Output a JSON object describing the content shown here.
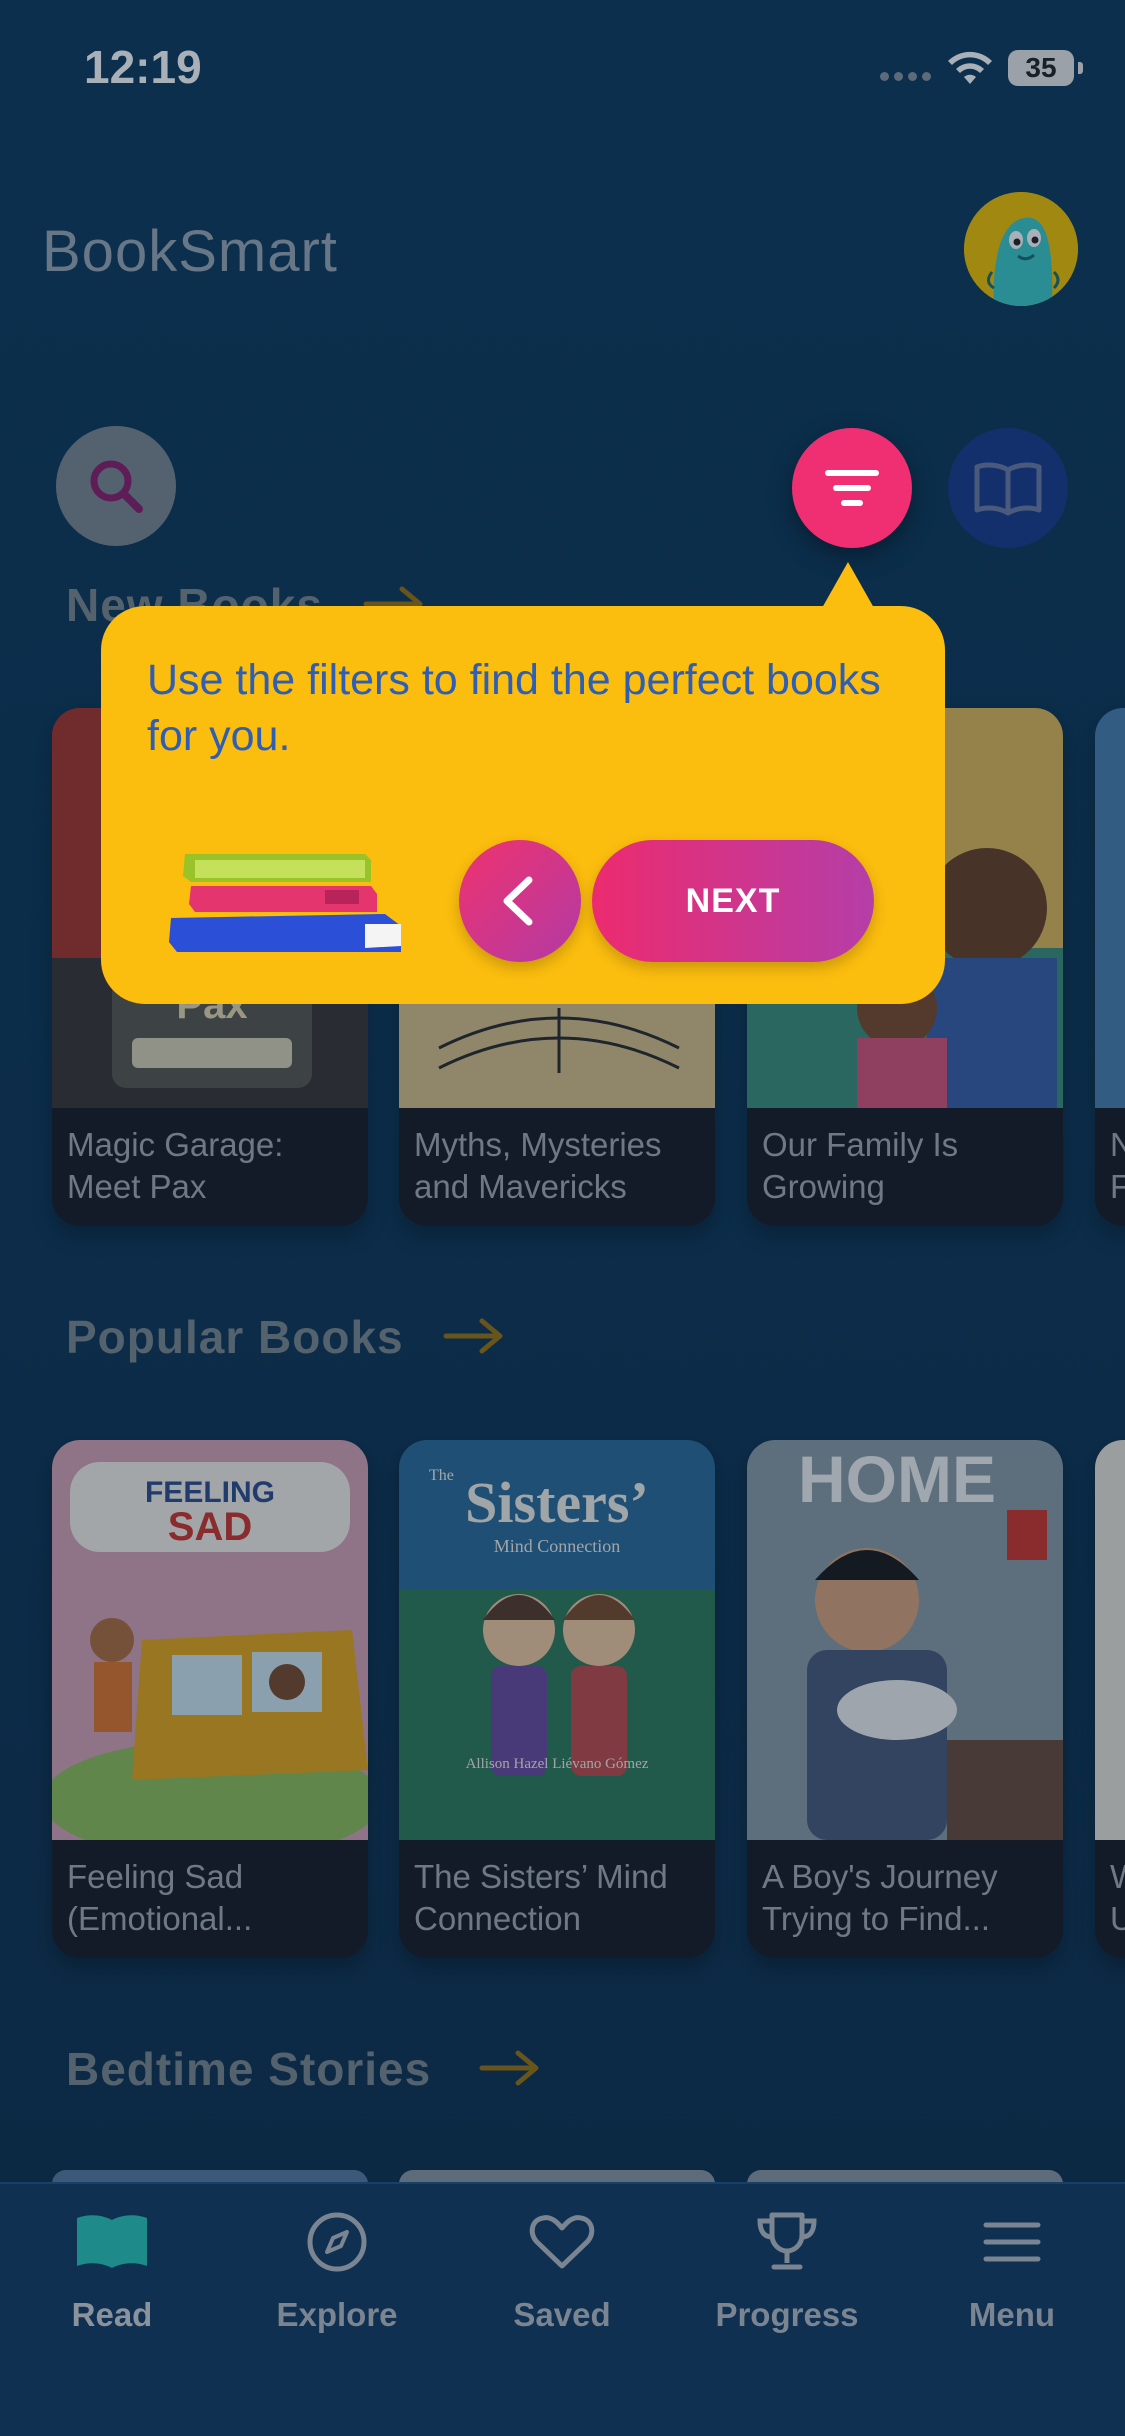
{
  "status_bar": {
    "time": "12:19",
    "battery": "35"
  },
  "header": {
    "app_title": "BookSmart"
  },
  "sections": [
    {
      "title": "New Books",
      "books": [
        {
          "title": "Magic Garage: Meet Pax"
        },
        {
          "title": "Myths, Mysteries and Mavericks"
        },
        {
          "title": "Our Family Is Growing"
        },
        {
          "title": "N F"
        }
      ]
    },
    {
      "title": "Popular Books",
      "books": [
        {
          "title": "Feeling Sad (Emotional..."
        },
        {
          "title": "The Sisters’ Mind Connection"
        },
        {
          "title": "A Boy's Journey Trying to Find..."
        },
        {
          "title": "W U"
        }
      ]
    },
    {
      "title": "Bedtime Stories",
      "books": []
    }
  ],
  "covers": {
    "feeling_sad_line1": "FEELING",
    "feeling_sad_line2": "SAD",
    "sisters_title": "Sisters’",
    "sisters_small": "The",
    "sisters_sub": "Mind Connection",
    "sisters_author": "Allison Hazel Liévano Gómez",
    "home_title": "HOME",
    "pax_label": "Pax"
  },
  "tooltip": {
    "message": "Use the filters to find the perfect books for you.",
    "next_label": "NEXT"
  },
  "tab_bar": {
    "tabs": [
      {
        "label": "Read",
        "icon": "open-book-icon"
      },
      {
        "label": "Explore",
        "icon": "compass-icon"
      },
      {
        "label": "Saved",
        "icon": "heart-icon"
      },
      {
        "label": "Progress",
        "icon": "trophy-icon"
      },
      {
        "label": "Menu",
        "icon": "hamburger-menu-icon"
      }
    ]
  },
  "colors": {
    "background": "#0e3455",
    "accent_pink": "#ef2f72",
    "tooltip_yellow": "#fbbd0e",
    "tooltip_text": "#2f5fb4",
    "arrow_gold": "#b8860b",
    "active_tab": "#1e8a8a"
  }
}
